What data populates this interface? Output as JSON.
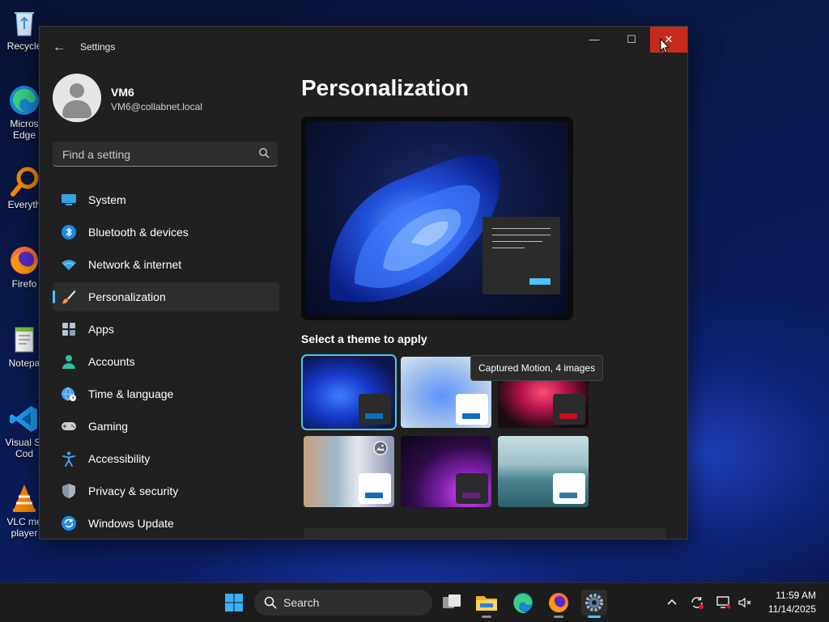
{
  "desktop": {
    "icons": [
      {
        "label": "Recycle",
        "icon": "recycle-bin-icon"
      },
      {
        "label": "Micros\nEdge",
        "icon": "edge-icon"
      },
      {
        "label": "Everyth",
        "icon": "everything-search-icon"
      },
      {
        "label": "Firefo",
        "icon": "firefox-icon"
      },
      {
        "label": "Notepa",
        "icon": "notepad-icon"
      },
      {
        "label": "Visual St\nCod",
        "icon": "vscode-icon"
      },
      {
        "label": "VLC me\nplayer",
        "icon": "vlc-icon"
      }
    ]
  },
  "window": {
    "title": "Settings",
    "back_icon": "arrow-left-icon",
    "minimize_glyph": "—",
    "maximize_glyph": "☐",
    "close_glyph": "✕"
  },
  "profile": {
    "name": "VM6",
    "email": "VM6@collabnet.local"
  },
  "search": {
    "placeholder": "Find a setting"
  },
  "nav": {
    "items": [
      {
        "label": "System",
        "icon": "monitor-icon"
      },
      {
        "label": "Bluetooth & devices",
        "icon": "bluetooth-icon"
      },
      {
        "label": "Network & internet",
        "icon": "wifi-icon"
      },
      {
        "label": "Personalization",
        "icon": "paintbrush-icon",
        "active": true
      },
      {
        "label": "Apps",
        "icon": "apps-icon"
      },
      {
        "label": "Accounts",
        "icon": "person-icon"
      },
      {
        "label": "Time & language",
        "icon": "globe-clock-icon"
      },
      {
        "label": "Gaming",
        "icon": "gamepad-icon"
      },
      {
        "label": "Accessibility",
        "icon": "accessibility-icon"
      },
      {
        "label": "Privacy & security",
        "icon": "shield-icon"
      },
      {
        "label": "Windows Update",
        "icon": "update-icon"
      }
    ]
  },
  "content": {
    "title": "Personalization",
    "theme_section_label": "Select a theme to apply",
    "tooltip": "Captured Motion, 4 images",
    "themes": [
      {
        "name": "windows-dark-theme",
        "selected": true,
        "accent": "#0f6cbd",
        "badge_bg": "#2b2b2b"
      },
      {
        "name": "windows-light-theme",
        "selected": false,
        "accent": "#0f6cbd",
        "badge_bg": "#ffffff"
      },
      {
        "name": "captured-motion-theme",
        "selected": false,
        "accent": "#c50f1f",
        "badge_bg": "#2b2b2b"
      },
      {
        "name": "glow-slideshow-theme",
        "selected": false,
        "accent": "#0f6cbd",
        "badge_bg": "#ffffff"
      },
      {
        "name": "sunrise-purple-theme",
        "selected": false,
        "accent": "#6b1d8c",
        "badge_bg": "#2b2b2b"
      },
      {
        "name": "flow-lake-theme",
        "selected": false,
        "accent": "#2d7d9a",
        "badge_bg": "#ffffff"
      }
    ]
  },
  "taskbar": {
    "search_label": "Search",
    "time": "11:59 AM",
    "date": "11/14/2025",
    "apps": [
      "start-icon",
      "task-view-icon",
      "file-explorer-icon",
      "edge-icon",
      "firefox-icon",
      "settings-icon"
    ],
    "tray": [
      "chevron-up-icon",
      "sync-icon",
      "display-icon",
      "speaker-muted-icon"
    ]
  },
  "colors": {
    "accent": "#4cc2ff",
    "close_red": "#c42b1c",
    "window_bg": "#202020"
  }
}
